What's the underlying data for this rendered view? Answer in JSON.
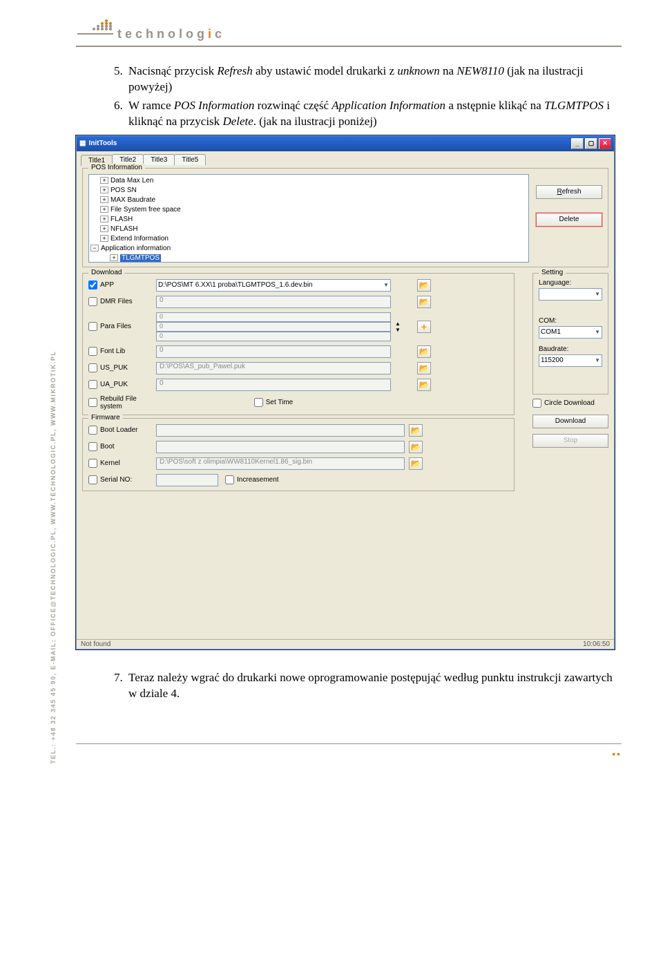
{
  "side_text": "TEL.: +48 32 345 45 90, E-MAIL: OFFICE@TECHNOLOGIC.PL, WWW.TECHNOLOGIC.PL, WWW.MIKROTIK.PL",
  "logo": {
    "word": "technolog",
    "accent": "i",
    "tail": "c"
  },
  "doc": {
    "item5_pre": "Nacisnąć przycisk ",
    "item5_refresh": "Refresh",
    "item5_mid": " aby ustawić model drukarki z ",
    "item5_unknown": "unknown",
    "item5_on": " na ",
    "item5_model": "NEW8110",
    "item5_end": " (jak na ilustracji powyżej)",
    "item6_pre": "W ramce ",
    "item6_pos": "POS Information",
    "item6_mid1": " rozwinąć część ",
    "item6_app": "Application Information",
    "item6_mid2": " a nstępnie klikąć na ",
    "item6_tlg": "TLGMTPOS",
    "item6_mid3": " i kliknąć na  przycisk ",
    "item6_del": "Delete",
    "item6_end": ". (jak na ilustracji poniżej)",
    "item7": "Teraz należy wgrać do drukarki nowe oprogramowanie postępująć według punktu instrukcji zawartych w dziale 4."
  },
  "win": {
    "title": "InitTools",
    "tabs": [
      "Title1",
      "Title2",
      "Title3",
      "Title5"
    ],
    "group_pos": "POS Information",
    "tree": {
      "nodes": [
        "Data Max Len",
        "POS SN",
        "MAX Baudrate",
        "File System free space",
        "FLASH",
        "NFLASH",
        "Extend Information"
      ],
      "openNode": "Application information",
      "selected": "TLGMTPOS"
    },
    "btn_refresh": "Refresh",
    "btn_delete": "Delete",
    "group_dl": "Download",
    "dl": {
      "app": "APP",
      "app_path": "D:\\POS\\MT 6.XX\\1 proba\\TLGMTPOS_1.6.dev.bin",
      "dmr": "DMR Files",
      "dmr_v": "0",
      "para": "Para Files",
      "para_v": [
        "0",
        "0",
        "0"
      ],
      "font": "Font Lib",
      "font_v": "0",
      "us": "US_PUK",
      "us_v": "D:\\POS\\AS_pub_Pawel.puk",
      "ua": "UA_PUK",
      "ua_v": "0",
      "rebuild": "Rebuild File system",
      "settime": "Set Time"
    },
    "group_set": "Setting",
    "setting": {
      "language": "Language:",
      "com": "COM:",
      "com_v": "COM1",
      "baud": "Baudrate:",
      "baud_v": "115200"
    },
    "group_fw": "Firmware",
    "fw": {
      "boot": "Boot Loader",
      "bootr": "Boot",
      "kernel": "Kernel",
      "kernel_v": "D:\\POS\\soft z olimpia\\WW8110Kernel1.86_sig.bin",
      "serial": "Serial NO:",
      "incr": "Increasement",
      "circle": "Circle Download",
      "download": "Download",
      "stop": "Stop"
    },
    "status_left": "Not found",
    "status_right": "10:06:50"
  }
}
